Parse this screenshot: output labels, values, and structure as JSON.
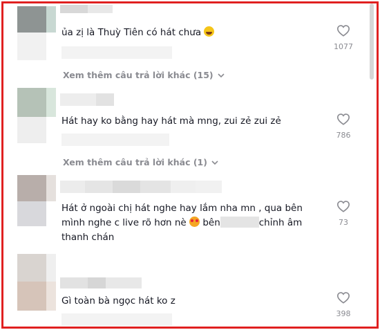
{
  "comments": [
    {
      "text": "ủa zị là Thuỳ Tiên có hát chưa",
      "emoji": "laughing-face-emoji",
      "likes": "1077"
    },
    {
      "text": "Hát hay ko bằng hay hát mà mng, zui zẻ zui zẻ",
      "likes": "786"
    },
    {
      "text_part1": "Hát ở ngoài chị hát nghe hay lắm nha mn , qua bên mình nghe c live rõ hơn nè",
      "text_part2": "bên",
      "text_part3": "chỉnh âm thanh chán",
      "emoji": "heart-eyes-emoji",
      "likes": "73"
    },
    {
      "text": "Gì toàn bà ngọc hát ko z",
      "likes": "398"
    }
  ],
  "view_more": [
    {
      "label": "Xem thêm câu trả lời khác (15)"
    },
    {
      "label": "Xem thêm câu trả lời khác (1)"
    }
  ],
  "colors": {
    "border": "#e02020",
    "muted_text": "#8a8b91",
    "body_text": "#161823"
  }
}
